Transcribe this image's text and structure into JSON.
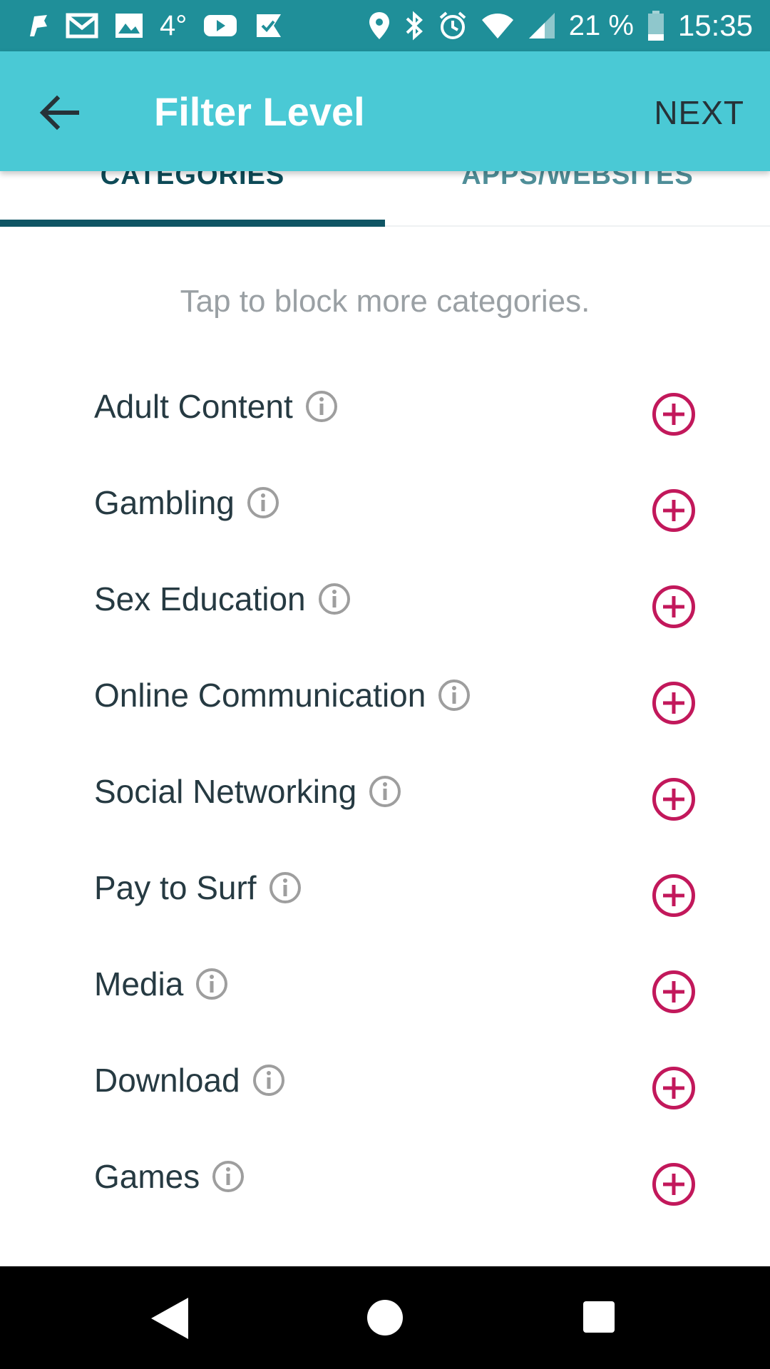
{
  "status_bar": {
    "temperature": "4°",
    "battery_percent": "21 %",
    "time": "15:35",
    "icons": [
      "notification-flag-icon",
      "gmail-icon",
      "gallery-icon",
      "youtube-icon",
      "check-app-icon",
      "location-icon",
      "bluetooth-icon",
      "alarm-icon",
      "wifi-icon",
      "cell-signal-icon",
      "battery-icon"
    ]
  },
  "app_bar": {
    "title": "Filter Level",
    "next_label": "NEXT",
    "back_icon": "arrow-back-icon"
  },
  "tabs": [
    {
      "label": "CATEGORIES",
      "selected": true
    },
    {
      "label": "APPS/WEBSITES",
      "selected": false
    }
  ],
  "hint": "Tap to block more categories.",
  "categories": [
    {
      "label": "Adult Content"
    },
    {
      "label": "Gambling"
    },
    {
      "label": "Sex Education"
    },
    {
      "label": "Online Communication"
    },
    {
      "label": "Social Networking"
    },
    {
      "label": "Pay to Surf"
    },
    {
      "label": "Media"
    },
    {
      "label": "Download"
    },
    {
      "label": "Games"
    }
  ],
  "colors": {
    "status_bar": "#1f8f99",
    "app_bar": "#4ac9d5",
    "tab_selected": "#0d4a57",
    "tab_unselected": "#4f8e98",
    "add_accent": "#c2185b",
    "info_icon": "#9e9e9e"
  },
  "nav_bar": {
    "icons": [
      "nav-back-icon",
      "nav-home-icon",
      "nav-recents-icon"
    ]
  }
}
